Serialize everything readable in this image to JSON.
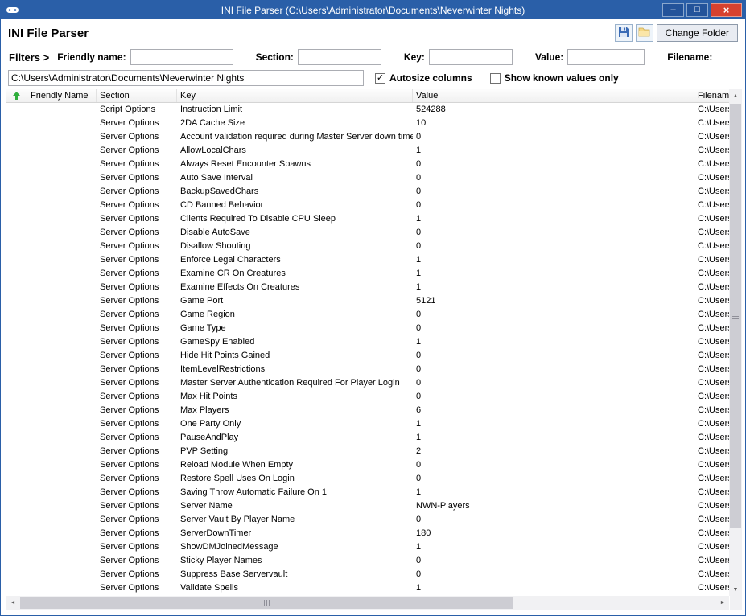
{
  "window": {
    "title": "INI File Parser (C:\\Users\\Administrator\\Documents\\Neverwinter Nights)",
    "minimize": "–",
    "maximize": "□",
    "close": "×"
  },
  "header": {
    "title": "INI File Parser",
    "change_folder": "Change Folder"
  },
  "filters": {
    "title": "Filters >",
    "friendly_label": "Friendly name:",
    "friendly_value": "",
    "section_label": "Section:",
    "section_value": "",
    "key_label": "Key:",
    "key_value": "",
    "value_label": "Value:",
    "value_value": "",
    "filename_label": "Filename:"
  },
  "path_bar": {
    "path": "C:\\Users\\Administrator\\Documents\\Neverwinter Nights",
    "autosize_label": "Autosize columns",
    "autosize_checked": true,
    "known_label": "Show known values only",
    "known_checked": false
  },
  "grid": {
    "columns": [
      "",
      "Friendly Name",
      "Section",
      "Key",
      "Value",
      "Filename"
    ],
    "filename_cell": "C:\\Users\\",
    "rows": [
      [
        "Script Options",
        "Instruction Limit",
        "524288"
      ],
      [
        "Server Options",
        "2DA Cache Size",
        "10"
      ],
      [
        "Server Options",
        "Account validation required during Master Server down times",
        "0"
      ],
      [
        "Server Options",
        "AllowLocalChars",
        "1"
      ],
      [
        "Server Options",
        "Always Reset Encounter Spawns",
        "0"
      ],
      [
        "Server Options",
        "Auto Save Interval",
        "0"
      ],
      [
        "Server Options",
        "BackupSavedChars",
        "0"
      ],
      [
        "Server Options",
        "CD Banned Behavior",
        "0"
      ],
      [
        "Server Options",
        "Clients Required To Disable CPU Sleep",
        "1"
      ],
      [
        "Server Options",
        "Disable AutoSave",
        "0"
      ],
      [
        "Server Options",
        "Disallow Shouting",
        "0"
      ],
      [
        "Server Options",
        "Enforce Legal Characters",
        "1"
      ],
      [
        "Server Options",
        "Examine CR On Creatures",
        "1"
      ],
      [
        "Server Options",
        "Examine Effects On Creatures",
        "1"
      ],
      [
        "Server Options",
        "Game Port",
        "5121"
      ],
      [
        "Server Options",
        "Game Region",
        "0"
      ],
      [
        "Server Options",
        "Game Type",
        "0"
      ],
      [
        "Server Options",
        "GameSpy Enabled",
        "1"
      ],
      [
        "Server Options",
        "Hide Hit Points Gained",
        "0"
      ],
      [
        "Server Options",
        "ItemLevelRestrictions",
        "0"
      ],
      [
        "Server Options",
        "Master Server Authentication Required For Player Login",
        "0"
      ],
      [
        "Server Options",
        "Max Hit Points",
        "0"
      ],
      [
        "Server Options",
        "Max Players",
        "6"
      ],
      [
        "Server Options",
        "One Party Only",
        "1"
      ],
      [
        "Server Options",
        "PauseAndPlay",
        "1"
      ],
      [
        "Server Options",
        "PVP Setting",
        "2"
      ],
      [
        "Server Options",
        "Reload Module When Empty",
        "0"
      ],
      [
        "Server Options",
        "Restore Spell Uses On Login",
        "0"
      ],
      [
        "Server Options",
        "Saving Throw Automatic Failure On 1",
        "1"
      ],
      [
        "Server Options",
        "Server Name",
        "NWN-Players"
      ],
      [
        "Server Options",
        "Server Vault By Player Name",
        "0"
      ],
      [
        "Server Options",
        "ServerDownTimer",
        "180"
      ],
      [
        "Server Options",
        "ShowDMJoinedMessage",
        "1"
      ],
      [
        "Server Options",
        "Sticky Player Names",
        "0"
      ],
      [
        "Server Options",
        "Suppress Base Servervault",
        "0"
      ],
      [
        "Server Options",
        "Validate Spells",
        "1"
      ]
    ]
  },
  "icons": {
    "check": "✓",
    "scroll_up": "▲",
    "scroll_down": "▼",
    "scroll_left": "◄",
    "scroll_right": "►"
  }
}
